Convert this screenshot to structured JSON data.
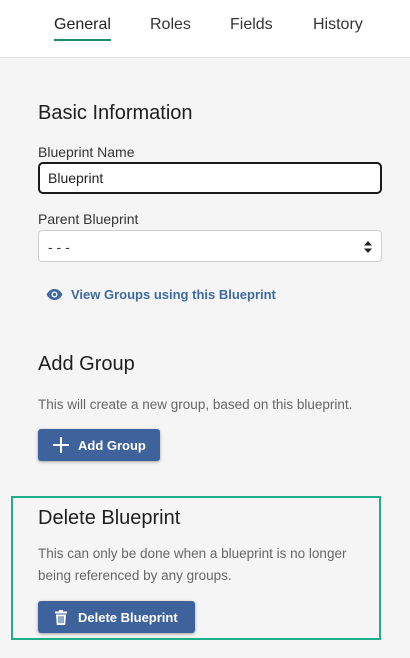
{
  "tabs": [
    {
      "label": "General",
      "active": true
    },
    {
      "label": "Roles",
      "active": false
    },
    {
      "label": "Fields",
      "active": false
    },
    {
      "label": "History",
      "active": false
    }
  ],
  "basic_info": {
    "title": "Basic Information",
    "name_label": "Blueprint Name",
    "name_value": "Blueprint",
    "parent_label": "Parent Blueprint",
    "parent_value": "- - -",
    "view_groups_link": "View Groups using this Blueprint"
  },
  "add_group": {
    "title": "Add Group",
    "description": "This will create a new group, based on this blueprint.",
    "button_label": "Add Group"
  },
  "delete_blueprint": {
    "title": "Delete Blueprint",
    "description": "This can only be done when a blueprint is no longer being referenced by any groups.",
    "button_label": "Delete Blueprint"
  },
  "colors": {
    "accent": "#1a8f6f",
    "highlight_border": "#1fae88",
    "button": "#3e639c",
    "link": "#3e6aa3"
  },
  "icons": {
    "view_groups": "eye-icon",
    "add_group": "plus-icon",
    "delete": "trash-icon",
    "select_arrow": "sort-arrows-icon"
  }
}
